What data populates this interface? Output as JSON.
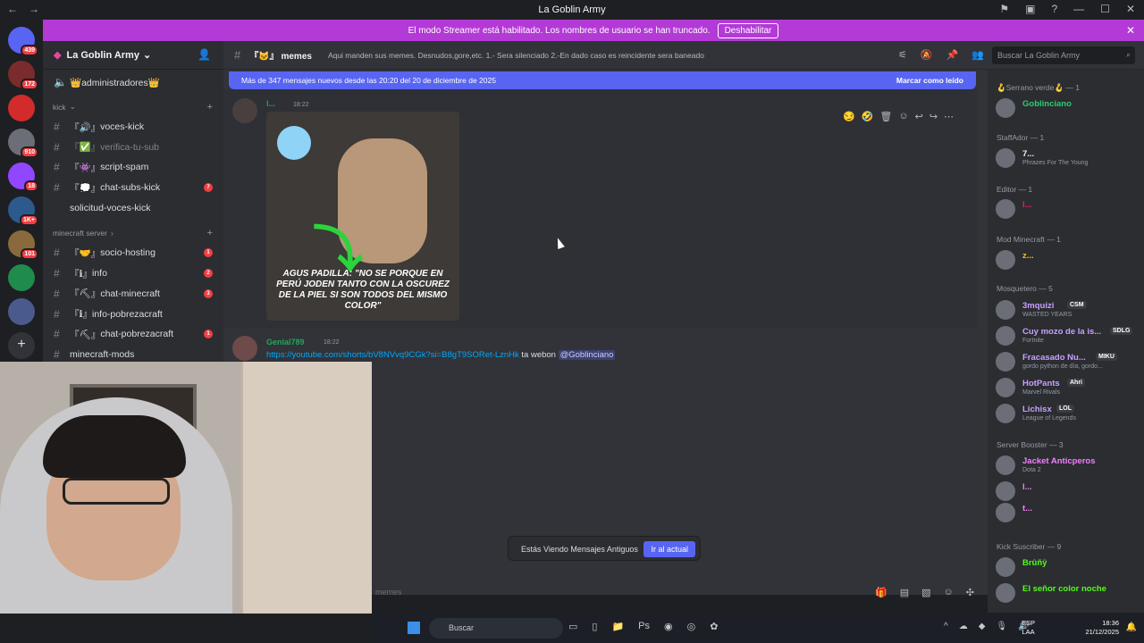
{
  "window": {
    "title": "La Goblin Army",
    "nav_back": "←",
    "nav_forward": "→",
    "controls": [
      "⚑",
      "▣",
      "?",
      "—",
      "☐",
      "✕"
    ]
  },
  "servers": {
    "badges": [
      "439",
      "172",
      "",
      "910",
      "18",
      "1K+",
      "101",
      "",
      ""
    ]
  },
  "banner": {
    "text": "El modo Streamer está habilitado. Los nombres de usuario se han truncado.",
    "button": "Deshabilitar",
    "close": "✕"
  },
  "guild": {
    "name": "La Goblin Army",
    "chevron": "⌄"
  },
  "channels": {
    "top": {
      "name": "👑administradores👑"
    },
    "cat_kick": "kick",
    "kick": [
      {
        "name": "voces-kick",
        "prefix": "『🔊』",
        "badge": ""
      },
      {
        "name": "verifica-tu-sub",
        "prefix": "『✅』",
        "badge": ""
      },
      {
        "name": "script-spam",
        "prefix": "『👾』",
        "badge": ""
      },
      {
        "name": "chat-subs-kick",
        "prefix": "『💭』",
        "badge": "7"
      },
      {
        "name": "solicitud-voces-kick",
        "prefix": "",
        "badge": ""
      }
    ],
    "cat_mc": "minecraft server",
    "mc": [
      {
        "name": "socio-hosting",
        "prefix": "『🤝』",
        "badge": "1"
      },
      {
        "name": "info",
        "prefix": "『ℹ』",
        "badge": "2"
      },
      {
        "name": "chat-minecraft",
        "prefix": "『⛏』",
        "badge": "3"
      },
      {
        "name": "info-pobrezacraft",
        "prefix": "『ℹ』",
        "badge": ""
      },
      {
        "name": "chat-pobrezacraft",
        "prefix": "『⛏』",
        "badge": "1"
      },
      {
        "name": "minecraft-mods",
        "prefix": "",
        "badge": ""
      }
    ]
  },
  "channel": {
    "name": "memes",
    "prefix": "『🐱』",
    "topic": "Aqui manden sus memes. Desnudos,gore,etc. 1.- Sera silenciado 2.-En dado caso es reincidente sera baneado",
    "search_placeholder": "Buscar La Goblin Army"
  },
  "newbar": {
    "text": "Más de 347 mensajes nuevos desde las 20:20 del 20 de diciembre de 2025",
    "mark": "Marcar como leído"
  },
  "messages": [
    {
      "author": "l...",
      "time": "18:22",
      "caption": "AGUS PADILLA: \"NO SE PORQUE EN PERÚ JODEN TANTO CON LA OSCUREZ DE LA PIEL SI SON TODOS DEL MISMO COLOR\""
    },
    {
      "author": "Genial789",
      "time": "18:22",
      "link": "https://youtube.com/shorts/bV8NVvq9CGk?si=B8gT9SORet-LznHk",
      "text": "ta webon",
      "mention": "@Goblinciano"
    }
  ],
  "old_notice": {
    "text": "Estás Viendo Mensajes Antiguos",
    "button": "Ir al actual"
  },
  "composer": {
    "placeholder": "memes"
  },
  "members": {
    "groups": [
      {
        "label": "🪝Serrano verde🪝 — 1"
      },
      {
        "label": "StaffAdor — 1"
      },
      {
        "label": "Editor — 1"
      },
      {
        "label": "Mod Minecraft — 1"
      },
      {
        "label": "Mosquetero — 5"
      },
      {
        "label": "Server Booster — 3"
      },
      {
        "label": "Kick Suscriber — 9"
      }
    ],
    "list": [
      {
        "name": "Goblinciano",
        "status": "",
        "color": "#2ecc71",
        "tag": ""
      },
      {
        "name": "7...",
        "status": "Phrazes For The Young",
        "color": "#f2f3f5",
        "tag": ""
      },
      {
        "name": "l...",
        "status": "",
        "color": "#e91e63",
        "tag": ""
      },
      {
        "name": "z...",
        "status": "",
        "color": "#f1c40f",
        "tag": ""
      },
      {
        "name": "3mquizi",
        "status": "WASTED YEARS",
        "color": "#c9a0ff",
        "tag": "CSM"
      },
      {
        "name": "Cuy mozo de la is...",
        "status": "Fortnite",
        "color": "#c9a0ff",
        "tag": "SDLG"
      },
      {
        "name": "Fracasado Nu...",
        "status": "gordo python de día, gordo...",
        "color": "#c9a0ff",
        "tag": "MIKU"
      },
      {
        "name": "HotPants",
        "status": "Marvel Rivals",
        "color": "#c9a0ff",
        "tag": "Ahri"
      },
      {
        "name": "Lichisx",
        "status": "League of Legends",
        "color": "#c9a0ff",
        "tag": "LOL"
      },
      {
        "name": "Jacket Anticperos",
        "status": "Dota 2",
        "color": "#f47fff",
        "tag": ""
      },
      {
        "name": "l...",
        "status": "",
        "color": "#f47fff",
        "tag": ""
      },
      {
        "name": "t...",
        "status": "",
        "color": "#f47fff",
        "tag": ""
      },
      {
        "name": "Brûñÿ",
        "status": "",
        "color": "#53fc18",
        "tag": ""
      },
      {
        "name": "El señor color noche",
        "status": "",
        "color": "#53fc18",
        "tag": ""
      }
    ]
  },
  "taskbar": {
    "search": "Buscar",
    "lang1": "ESP",
    "lang2": "LAA",
    "time": "18:36",
    "date": "21/12/2025"
  }
}
